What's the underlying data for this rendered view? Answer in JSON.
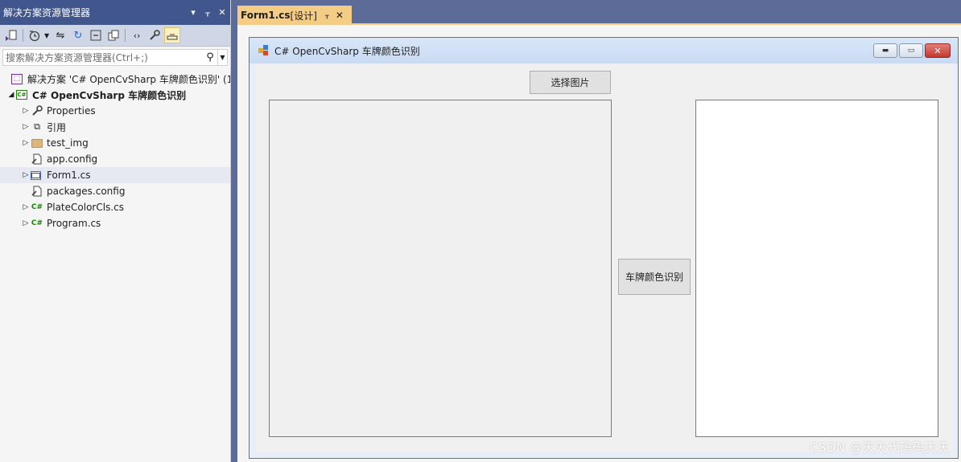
{
  "solution_explorer": {
    "title": "解决方案资源管理器",
    "title_buttons": [
      "▾",
      "ᚁ",
      "✕"
    ],
    "search": {
      "placeholder": "搜索解决方案资源管理器(Ctrl+;)"
    },
    "tree": {
      "solution": "解决方案 'C# OpenCvSharp 车牌颜色识别' (1",
      "project": "C# OpenCvSharp 车牌颜色识别",
      "items": [
        {
          "label": "Properties",
          "icon": "wrench-icon"
        },
        {
          "label": "引用",
          "icon": "references-icon"
        },
        {
          "label": "test_img",
          "icon": "folder-icon"
        },
        {
          "label": "app.config",
          "icon": "config-file-icon"
        },
        {
          "label": "Form1.cs",
          "icon": "form-icon"
        },
        {
          "label": "packages.config",
          "icon": "config-file-icon"
        },
        {
          "label": "PlateColorCls.cs",
          "icon": "csharp-file-icon"
        },
        {
          "label": "Program.cs",
          "icon": "csharp-file-icon"
        }
      ]
    }
  },
  "document_tab": {
    "name": "Form1.cs",
    "suffix": " [设计]",
    "pin": "ᚁ",
    "close": "✕"
  },
  "form": {
    "title": "C# OpenCvSharp 车牌颜色识别",
    "select_image_button": "选择图片",
    "recognize_button": "车牌颜色识别"
  },
  "watermark": "CSDN @天天代码码天天",
  "colors": {
    "vs_frame": "#5d6b99",
    "panel_title": "#40568d",
    "active_tab": "#f5cc84",
    "form_client": "#f0f0f0"
  }
}
